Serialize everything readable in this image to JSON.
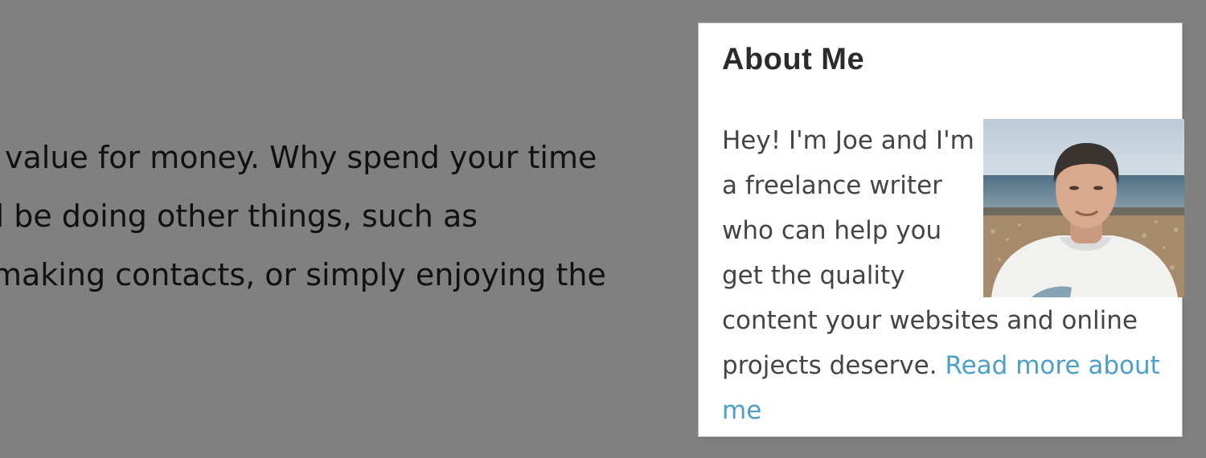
{
  "main": {
    "paragraph_lines": [
      "value for money. Why spend your time",
      "d be doing other things, such as",
      "making contacts, or simply enjoying the"
    ]
  },
  "sidebar": {
    "about_card": {
      "title": "About Me",
      "body_text": "Hey! I'm Joe and I'm a freelance writer who can help you get the quality content your websites and online projects deserve. ",
      "link_label": "Read more about me",
      "photo_alt": "Photo of Joe on a pebble beach by the sea",
      "link_color": "#4d9fcb"
    }
  }
}
